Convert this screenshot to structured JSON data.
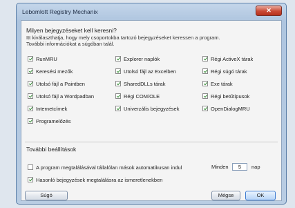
{
  "window": {
    "title": "Lebomlott Registry Mechanix",
    "close_glyph": "✕"
  },
  "main": {
    "heading": "Milyen bejegyzéseket kell keresni?",
    "desc_line1": "Itt kiválaszthatja, hogy mely csoportokba tartozó bejegyzéseket keressen a program.",
    "desc_line2": "További információkat a súgóban talál.",
    "options": [
      {
        "label": "RunMRU",
        "checked": true
      },
      {
        "label": "Explorer naplók",
        "checked": true
      },
      {
        "label": "Régi ActiveX tárak",
        "checked": true
      },
      {
        "label": "Keresési mezők",
        "checked": true
      },
      {
        "label": "Utolsó fájl az Excelben",
        "checked": true
      },
      {
        "label": "Régi súgó tárak",
        "checked": true
      },
      {
        "label": "Utolsó fájl a Paintben",
        "checked": true
      },
      {
        "label": "SharedDLLs tárak",
        "checked": true
      },
      {
        "label": "Exe tárak",
        "checked": true
      },
      {
        "label": "Utolsó fájl a Wordpadban",
        "checked": true
      },
      {
        "label": "Régi COM/OLE",
        "checked": true
      },
      {
        "label": "Régi betűtípusok",
        "checked": true
      },
      {
        "label": "Internetcímek",
        "checked": true
      },
      {
        "label": "Univerzális bejegyzések",
        "checked": true
      },
      {
        "label": "OpenDialogMRU",
        "checked": true
      },
      {
        "label": "Programelőzés",
        "checked": true
      }
    ]
  },
  "more": {
    "title": "További beállítások",
    "auto_delete": {
      "label": "A program megtalálásával tállalólan mások automatikusan indul",
      "checked": false
    },
    "days_prefix": "Minden",
    "days_value": "5",
    "days_suffix": "nap",
    "confirm_option": {
      "label": "Hasonló bejegyzések megtalálásra az ismeretlenekben",
      "checked": true
    }
  },
  "buttons": {
    "help": "Súgó",
    "cancel": "Mégse",
    "ok": "OK"
  }
}
